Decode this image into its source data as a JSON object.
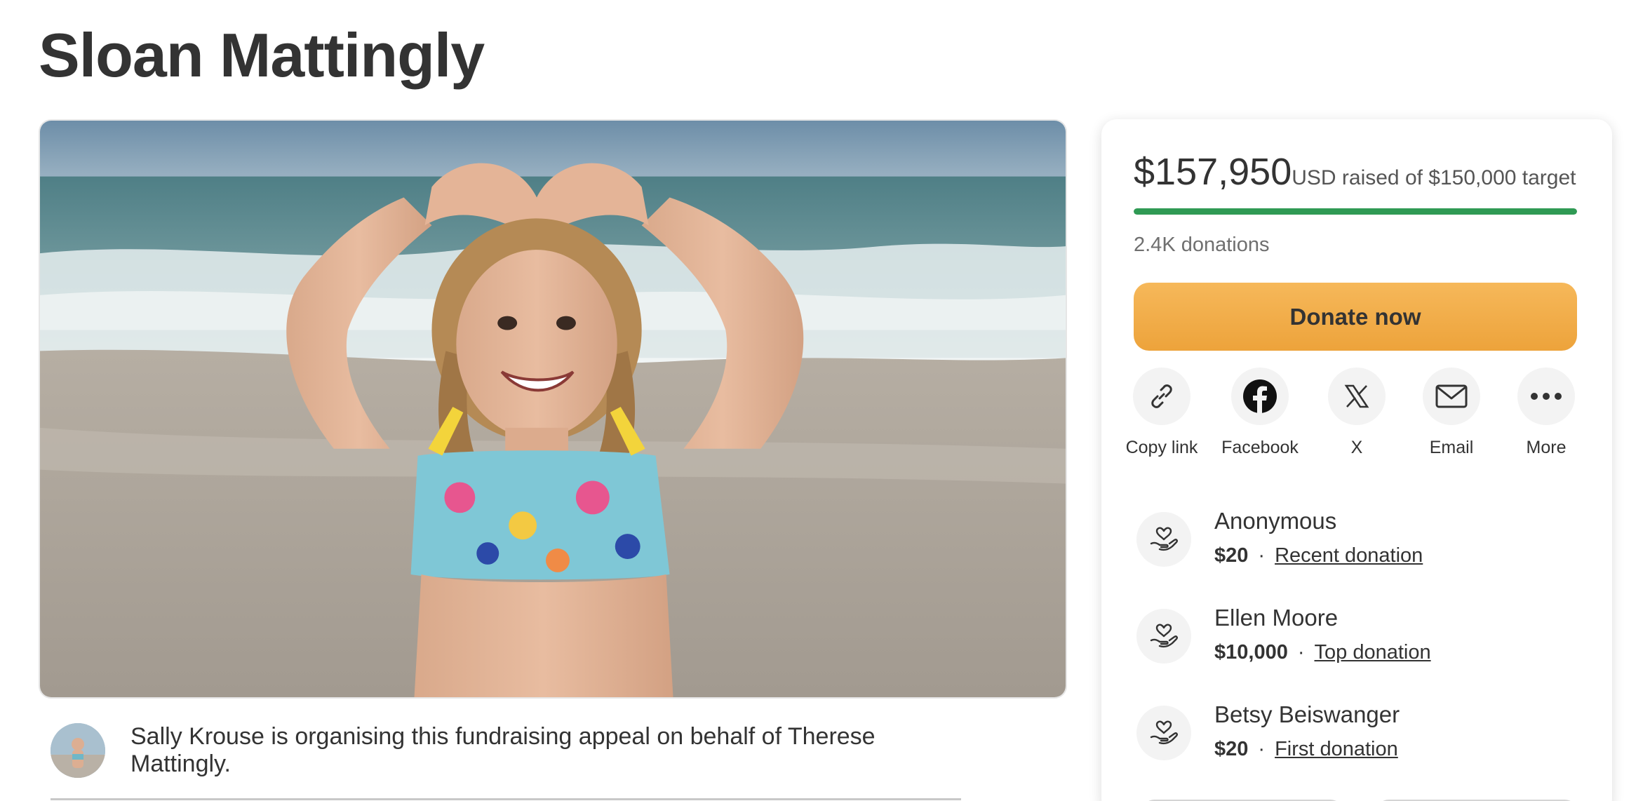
{
  "page": {
    "title": "Sloan Mattingly"
  },
  "organiser": {
    "text": "Sally Krouse is organising this fundraising appeal on behalf of Therese Mattingly."
  },
  "sidebar": {
    "amount": "$157,950",
    "amount_suffix": "USD raised of $150,000 target",
    "progress_fraction": 1.0,
    "donations_count": "2.4K donations",
    "donate_label": "Donate now",
    "share": [
      {
        "label": "Copy link",
        "icon": "link-icon"
      },
      {
        "label": "Facebook",
        "icon": "facebook-icon"
      },
      {
        "label": "X",
        "icon": "x-icon"
      },
      {
        "label": "Email",
        "icon": "email-icon"
      },
      {
        "label": "More",
        "icon": "more-icon"
      }
    ],
    "donors": [
      {
        "name": "Anonymous",
        "amount": "$20",
        "tag": "Recent donation"
      },
      {
        "name": "Ellen Moore",
        "amount": "$10,000",
        "tag": "Top donation"
      },
      {
        "name": "Betsy Beiswanger",
        "amount": "$20",
        "tag": "First donation"
      }
    ]
  },
  "colors": {
    "progress": "#2f9a54",
    "donate_button": "#eda33b",
    "text": "#333333"
  }
}
